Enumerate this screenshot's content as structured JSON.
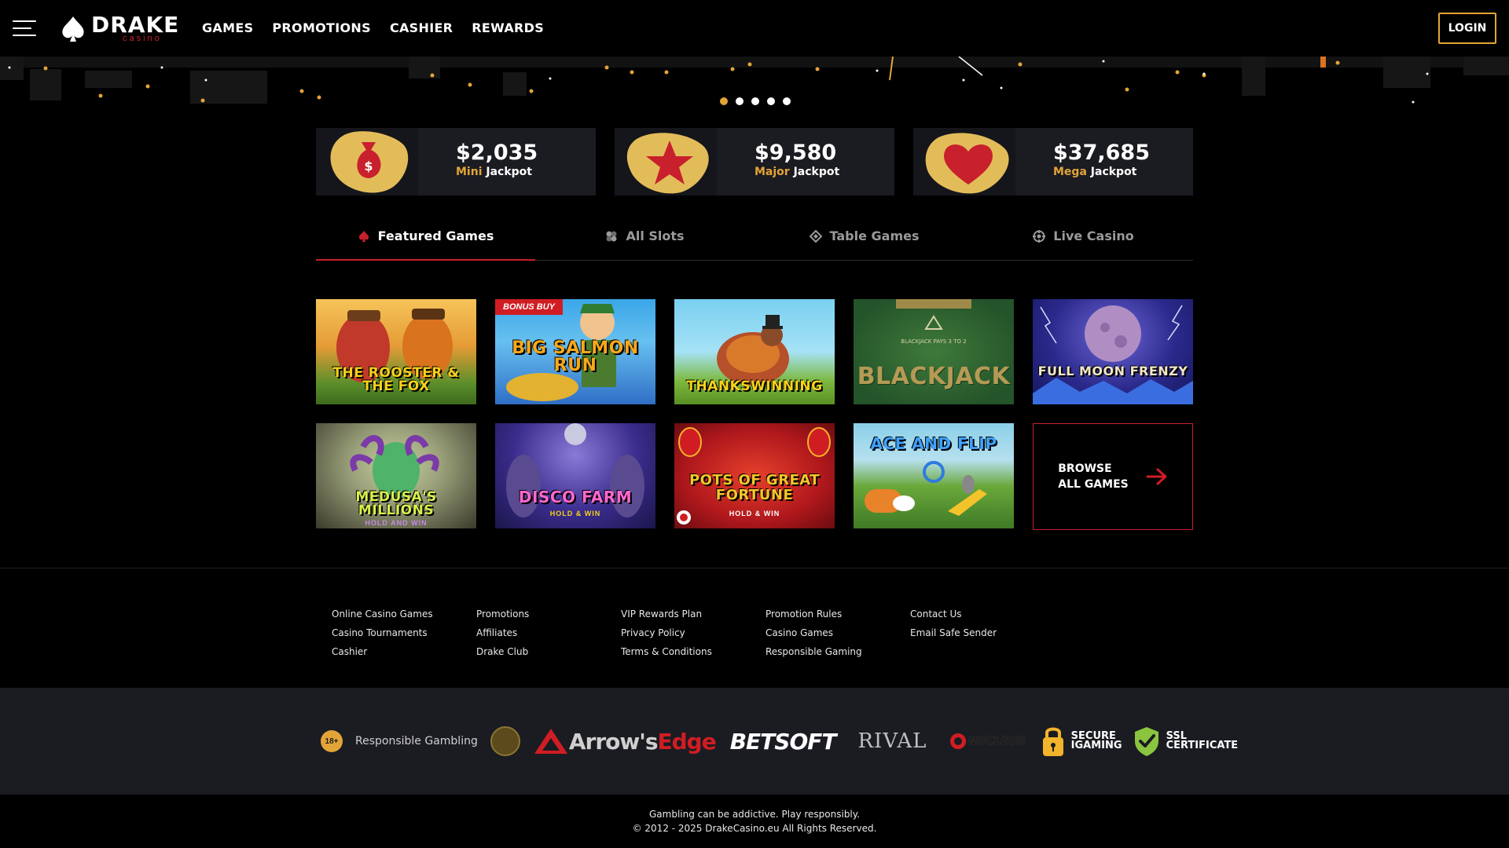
{
  "brand": {
    "name": "DRAKE",
    "sub": "casino"
  },
  "nav": {
    "items": [
      "GAMES",
      "PROMOTIONS",
      "CASHIER",
      "REWARDS"
    ],
    "login": "LOGIN"
  },
  "carousel": {
    "slides": 5,
    "active_index": 0
  },
  "jackpots": [
    {
      "amount": "$2,035",
      "tier": "Mini",
      "suffix": "Jackpot",
      "icon": "money-bag-icon"
    },
    {
      "amount": "$9,580",
      "tier": "Major",
      "suffix": "Jackpot",
      "icon": "star-icon"
    },
    {
      "amount": "$37,685",
      "tier": "Mega",
      "suffix": "Jackpot",
      "icon": "heart-icon"
    }
  ],
  "tabs": [
    {
      "label": "Featured Games",
      "icon": "spade-icon",
      "active": true
    },
    {
      "label": "All Slots",
      "icon": "slots-icon",
      "active": false
    },
    {
      "label": "Table Games",
      "icon": "diamond-icon",
      "active": false
    },
    {
      "label": "Live Casino",
      "icon": "chip-icon",
      "active": false
    }
  ],
  "games": [
    {
      "title": "THE ROOSTER & THE FOX",
      "badge": "",
      "sub": ""
    },
    {
      "title": "BIG SALMON RUN",
      "badge": "BONUS BUY",
      "sub": ""
    },
    {
      "title": "THANKSWINNING",
      "badge": "",
      "sub": ""
    },
    {
      "title": "BLACKJACK",
      "badge": "",
      "sub": ""
    },
    {
      "title": "FULL MOON FRENZY",
      "badge": "",
      "sub": ""
    },
    {
      "title": "MEDUSA'S MILLIONS",
      "badge": "",
      "sub": "HOLD AND WIN"
    },
    {
      "title": "DISCO FARM",
      "badge": "",
      "sub": "HOLD & WIN"
    },
    {
      "title": "POTS OF GREAT FORTUNE",
      "badge": "",
      "sub": "HOLD & WIN"
    },
    {
      "title": "ACE AND FLIP",
      "badge": "",
      "sub": ""
    }
  ],
  "browse": {
    "line1": "BROWSE",
    "line2": "ALL GAMES"
  },
  "footer_links": [
    [
      "Online Casino Games",
      "Casino Tournaments",
      "Cashier"
    ],
    [
      "Promotions",
      "Affiliates",
      "Drake Club"
    ],
    [
      "VIP Rewards Plan",
      "Privacy Policy",
      "Terms & Conditions"
    ],
    [
      "Promotion Rules",
      "Casino Games",
      "Responsible Gaming"
    ],
    [
      "Contact Us",
      "Email Safe Sender"
    ]
  ],
  "partners": {
    "age": "18+",
    "responsible": "Responsible Gambling",
    "arrows_a": "Arrow's",
    "arrows_b": "Edge",
    "betsoft": "BETSOFT",
    "rival": "RIVAL",
    "nucleus": "NUCLEUS",
    "secure_1": "SECURE",
    "secure_2": "IGAMING",
    "ssl_1": "SSL",
    "ssl_2": "CERTIFICATE"
  },
  "bottom": {
    "line1": "Gambling can be addictive. Play responsibly.",
    "line2": "© 2012 - 2025 DrakeCasino.eu All Rights Reserved."
  },
  "colors": {
    "accent_gold": "#e3a437",
    "accent_red": "#c8202c",
    "panel": "#1b1c22"
  }
}
